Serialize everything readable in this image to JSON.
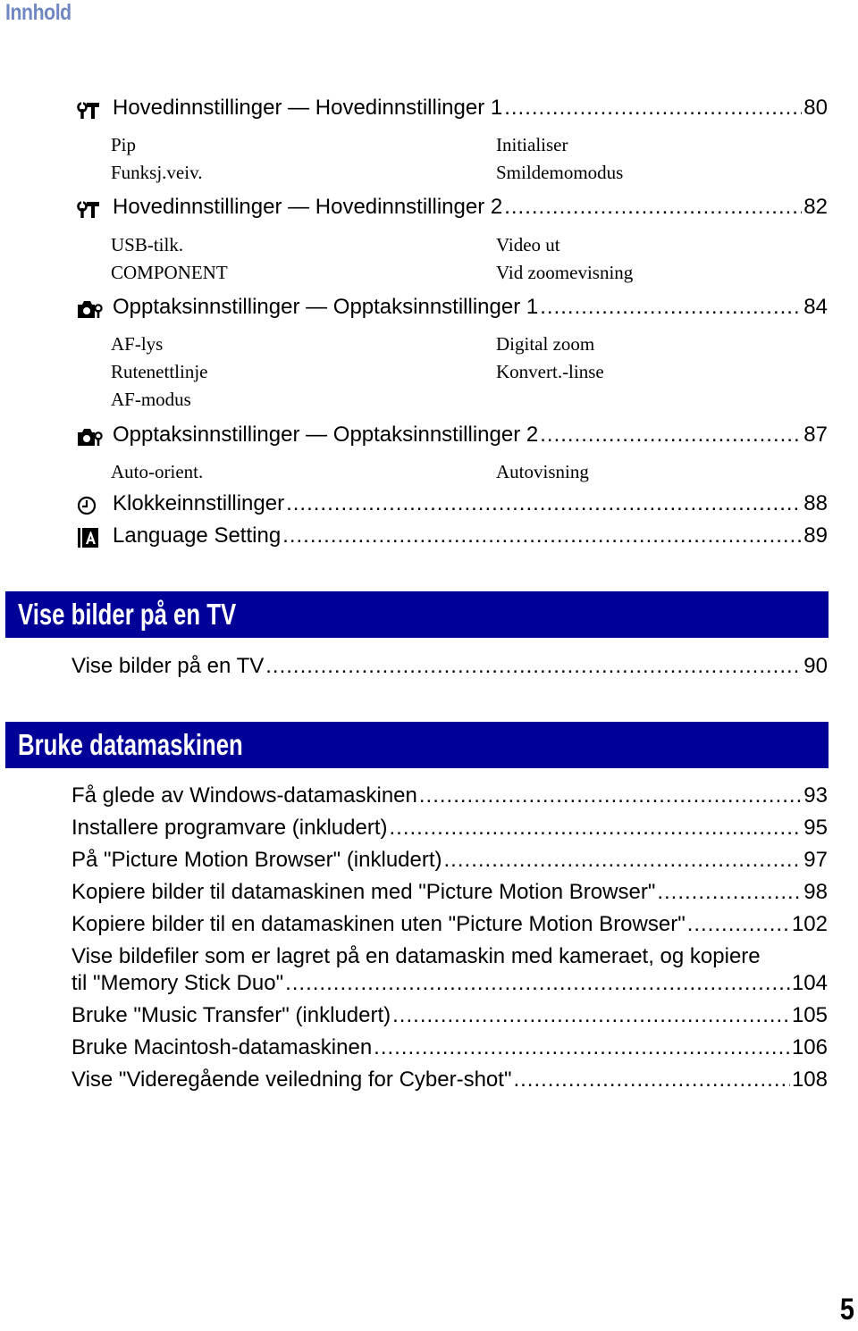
{
  "header": {
    "title": "Innhold"
  },
  "settings_entries": [
    {
      "icon": "wrench-hammer-icon",
      "label": "Hovedinnstillinger — Hovedinnstillinger 1",
      "page": "80",
      "sub_left": [
        "Pip",
        "Funksj.veiv."
      ],
      "sub_right": [
        "Initialiser",
        "Smildemomodus"
      ]
    },
    {
      "icon": "wrench-hammer-icon",
      "label": "Hovedinnstillinger — Hovedinnstillinger 2",
      "page": "82",
      "sub_left": [
        "USB-tilk.",
        "COMPONENT"
      ],
      "sub_right": [
        "Video ut",
        "Vid zoomevisning"
      ]
    },
    {
      "icon": "camera-wrench-icon",
      "label": "Opptaksinnstillinger — Opptaksinnstillinger 1",
      "page": "84",
      "sub_left": [
        "AF-lys",
        "Rutenettlinje",
        "AF-modus"
      ],
      "sub_right": [
        "Digital zoom",
        "Konvert.-linse"
      ]
    },
    {
      "icon": "camera-wrench-icon",
      "label": "Opptaksinnstillinger — Opptaksinnstillinger 2",
      "page": "87",
      "sub_left": [
        "Auto-orient."
      ],
      "sub_right": [
        "Autovisning"
      ]
    },
    {
      "icon": "clock-icon",
      "label": "Klokkeinnstillinger",
      "page": "88"
    },
    {
      "icon": "language-a-icon",
      "label": "Language Setting",
      "page": "89"
    }
  ],
  "sections": [
    {
      "title": "Vise bilder på en TV",
      "entries": [
        {
          "label": "Vise bilder på en TV",
          "page": "90"
        }
      ]
    },
    {
      "title": "Bruke datamaskinen",
      "entries": [
        {
          "label": "Få glede av Windows-datamaskinen",
          "page": "93"
        },
        {
          "label": "Installere programvare (inkludert)",
          "page": "95"
        },
        {
          "label": "På \"Picture Motion Browser\" (inkludert)",
          "page": "97"
        },
        {
          "label": "Kopiere bilder til datamaskinen med \"Picture Motion Browser\"",
          "page": "98"
        },
        {
          "label": "Kopiere bilder til en datamaskinen uten \"Picture Motion Browser\"",
          "page": "102"
        },
        {
          "label_line1": "Vise bildefiler som er lagret på en datamaskin med kameraet, og kopiere",
          "label": "til \"Memory Stick Duo\"",
          "page": "104"
        },
        {
          "label": "Bruke \"Music Transfer\" (inkludert)",
          "page": "105"
        },
        {
          "label": "Bruke Macintosh-datamaskinen",
          "page": "106"
        },
        {
          "label": "Vise \"Videregående veiledning for Cyber-shot\"",
          "page": "108"
        }
      ]
    }
  ],
  "footer": {
    "page_number": "5"
  },
  "colors": {
    "title": "#6f87c2",
    "banner": "#000099"
  }
}
